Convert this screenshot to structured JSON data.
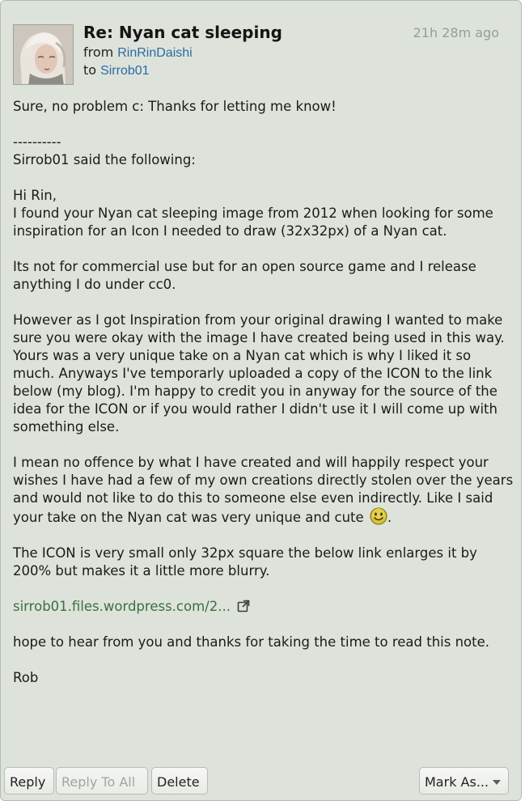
{
  "message": {
    "subject": "Re: Nyan cat sleeping",
    "from_label": "from",
    "from_user": "RinRinDaishi",
    "to_label": "to",
    "to_user": "Sirrob01",
    "timestamp": "21h 28m ago"
  },
  "body": {
    "p1": "Sure, no problem c: Thanks for letting me know!",
    "p2": "----------\nSirrob01 said the following:",
    "p3": "Hi Rin,\nI found your Nyan cat sleeping image from 2012 when looking for some inspiration for an Icon I needed to draw (32x32px) of a Nyan cat.",
    "p4": "Its not for commercial use but for an open source game and I release anything I do under cc0.",
    "p5": "However as I got Inspiration from your original drawing I wanted to make sure you were okay with the image I have created being used in this way. Yours was a very unique take on a Nyan cat which is why I liked it so much. Anyways I've temporarly uploaded a copy of the ICON to the link below (my blog). I'm happy to credit you in anyway for the source of the idea for the ICON or if you would rather I didn't use it I will come up with something else.",
    "p6": "I mean no offence by what I have created and will happily respect your wishes I have had a few of my own creations directly stolen over the years and would not like to do this to someone else even indirectly. Like I said your take on the Nyan cat was very unique and cute",
    "p6_end": ".",
    "p7": "The ICON is very small only 32px square the below link enlarges it by 200% but makes it a little more blurry.",
    "link_text": "sirrob01.files.wordpress.com/2...",
    "p8": "hope to hear from you and thanks for taking the time to read this note.",
    "signature": "Rob"
  },
  "actions": {
    "reply": "Reply",
    "reply_all": "Reply To All",
    "delete": "Delete",
    "mark_as": "Mark As..."
  },
  "colors": {
    "panel_bg": "#dde3db",
    "user_link": "#2f6aa3",
    "body_link": "#3d6e3f",
    "timestamp": "#93a094"
  },
  "icons": {
    "smiley": "smiley-emoticon-icon",
    "external_link": "external-link-icon",
    "dropdown": "caret-down-icon"
  }
}
